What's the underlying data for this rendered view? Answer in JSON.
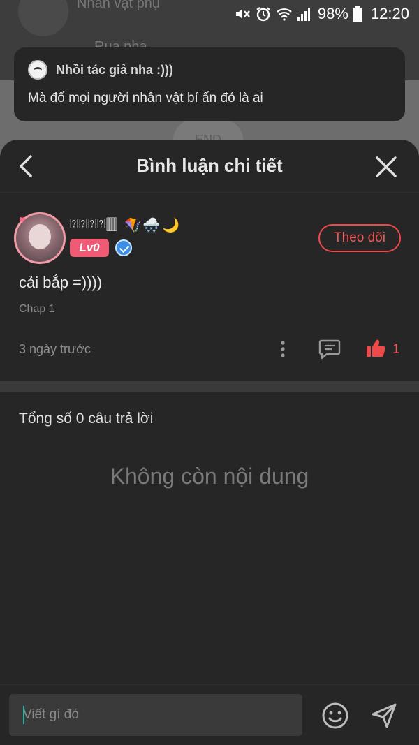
{
  "status_bar": {
    "battery": "98%",
    "time": "12:20"
  },
  "background": {
    "line1": "Nhân vật phụ",
    "line2": "Rua nha",
    "end_label": "END"
  },
  "toast": {
    "title": "Nhồi tác giả nha :)))",
    "body": "Mà đố mọi người nhân vật bí ẩn đó là ai"
  },
  "sheet": {
    "title": "Bình luận chi tiết"
  },
  "comment": {
    "username": "⍰⍰⍰⍰",
    "emoji": [
      "🀫",
      "🪁",
      "🌨️",
      "🌙"
    ],
    "level": "Lv0",
    "follow_label": "Theo dõi",
    "text": "cải bắp =))))",
    "chapter": "Chap 1",
    "time": "3 ngày trước",
    "like_count": "1"
  },
  "replies": {
    "total_label": "Tổng số 0 câu trả lời",
    "empty_label": "Không còn nội dung"
  },
  "composer": {
    "placeholder": "Viết gì đó"
  },
  "colors": {
    "accent_red": "#ef4a4a",
    "sheet_bg": "#262626",
    "level_badge": "#ef5a74"
  }
}
